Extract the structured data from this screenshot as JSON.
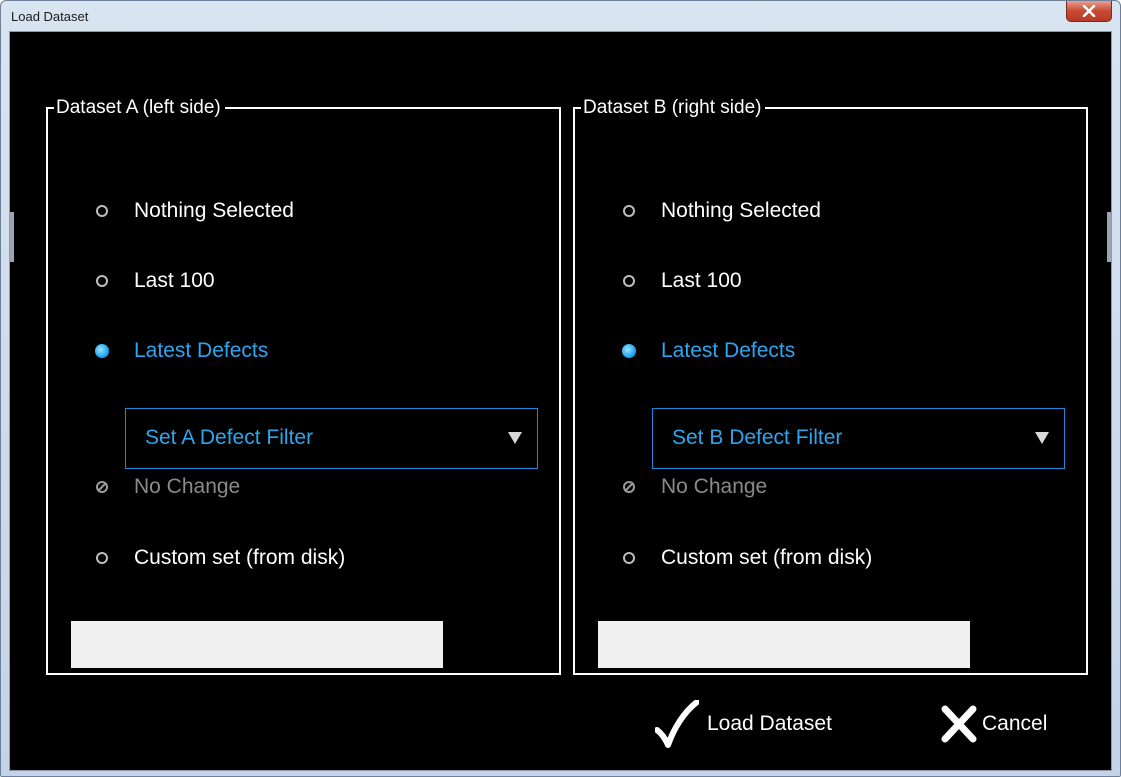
{
  "window": {
    "title": "Load Dataset",
    "close_icon": "close-x-icon"
  },
  "group_a": {
    "title": "Dataset A (left side)",
    "options": [
      {
        "label": "Nothing Selected",
        "state": "unchecked"
      },
      {
        "label": "Last 100",
        "state": "unchecked"
      },
      {
        "label": "Latest Defects",
        "state": "checked"
      },
      {
        "label": "No Change",
        "state": "disabled"
      },
      {
        "label": "Custom set (from disk)",
        "state": "unchecked"
      }
    ],
    "filter_dropdown": {
      "selected": "Set A Defect Filter",
      "icon": "dropdown-arrow-icon"
    },
    "custom_path": {
      "value": "",
      "placeholder": ""
    }
  },
  "group_b": {
    "title": "Dataset B (right side)",
    "options": [
      {
        "label": "Nothing Selected",
        "state": "unchecked"
      },
      {
        "label": "Last 100",
        "state": "unchecked"
      },
      {
        "label": "Latest Defects",
        "state": "checked"
      },
      {
        "label": "No Change",
        "state": "disabled"
      },
      {
        "label": "Custom set (from disk)",
        "state": "unchecked"
      }
    ],
    "filter_dropdown": {
      "selected": "Set B Defect Filter",
      "icon": "dropdown-arrow-icon"
    },
    "custom_path": {
      "value": "",
      "placeholder": ""
    }
  },
  "actions": {
    "load_label": "Load Dataset",
    "load_icon": "checkmark-icon",
    "cancel_label": "Cancel",
    "cancel_icon": "close-x-icon"
  },
  "colors": {
    "background": "#000000",
    "accent": "#2ba6ef",
    "text": "#ffffff",
    "disabled_text": "#8a8a8a",
    "close_button": "#c94a35"
  }
}
